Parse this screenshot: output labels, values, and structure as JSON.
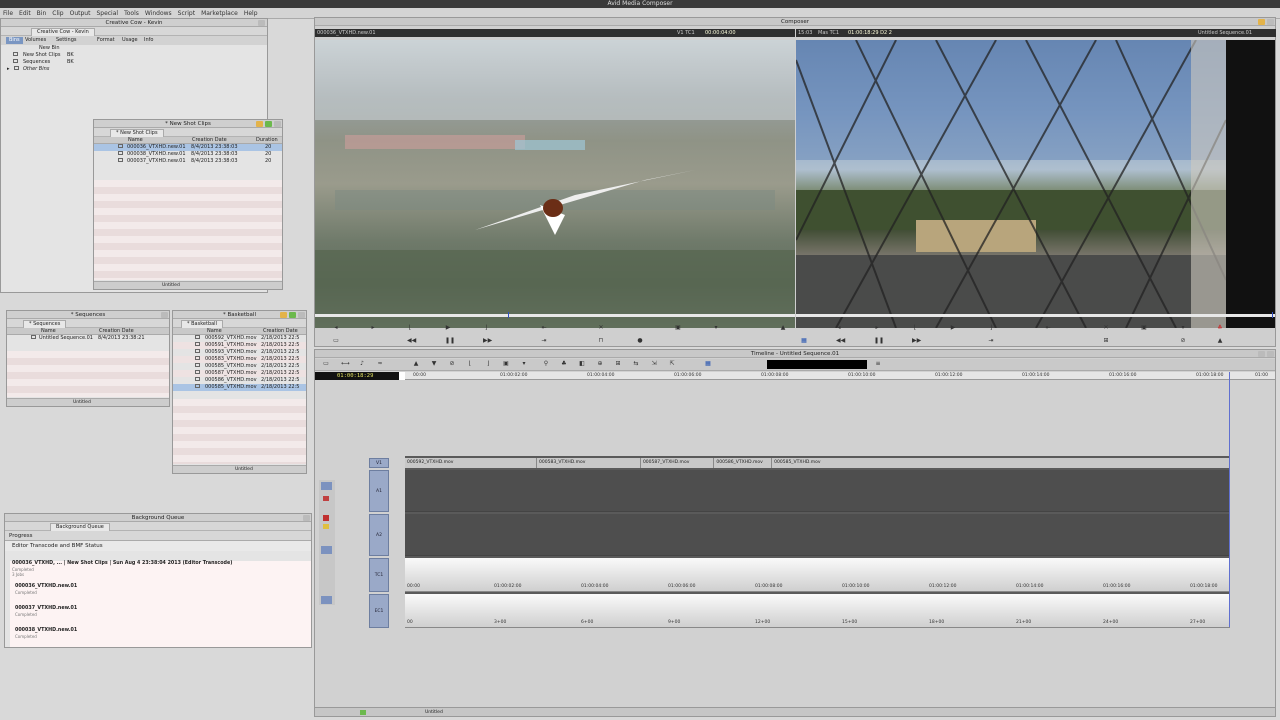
{
  "app": {
    "title": "Avid Media Composer"
  },
  "menu": [
    "File",
    "Edit",
    "Bin",
    "Clip",
    "Output",
    "Special",
    "Tools",
    "Windows",
    "Script",
    "Marketplace",
    "Help"
  ],
  "project_window": {
    "title": "Creative Cow - Kevin",
    "tab": "Creative Cow - Kevin",
    "tabs": [
      "Bins",
      "Volumes",
      "Settings",
      "Format",
      "Usage",
      "Info"
    ],
    "new_bin_button": "New Bin",
    "bins": [
      {
        "name": "New Shot Clips",
        "tag": "BK"
      },
      {
        "name": "Sequences",
        "tag": "BK"
      },
      {
        "name": "Other Bins",
        "tag": ""
      }
    ]
  },
  "new_shot_bin": {
    "title": "* New Shot Clips",
    "tab": "* New Shot Clips",
    "columns": [
      "Name",
      "Creation Date",
      "Duration"
    ],
    "rows": [
      {
        "name": "000036_VTXHD.new.01",
        "date": "8/4/2013 23:38:03",
        "dur": "20"
      },
      {
        "name": "000038_VTXHD.new.01",
        "date": "8/4/2013 23:38:03",
        "dur": "20"
      },
      {
        "name": "000037_VTXHD.new.01",
        "date": "8/4/2013 23:38:03",
        "dur": "20"
      }
    ],
    "footer_label": "Untitled"
  },
  "sequences_bin": {
    "title": "* Sequences",
    "tab": "* Sequences",
    "columns": [
      "Name",
      "Creation Date"
    ],
    "rows": [
      {
        "name": "Untitled Sequence.01",
        "date": "8/4/2013 23:38:21"
      }
    ],
    "footer_label": "Untitled"
  },
  "basketball_bin": {
    "title": "* Basketball",
    "tab": "* Basketball",
    "columns": [
      "Name",
      "Creation Date"
    ],
    "rows": [
      {
        "name": "000592_VTXHD.mov",
        "date": "2/18/2013 22:5"
      },
      {
        "name": "000591_VTXHD.mov",
        "date": "2/18/2013 22:5"
      },
      {
        "name": "000593_VTXHD.mov",
        "date": "2/18/2013 22:5"
      },
      {
        "name": "000583_VTXHD.mov",
        "date": "2/18/2013 22:5"
      },
      {
        "name": "000585_VTXHD.mov",
        "date": "2/18/2013 22:5"
      },
      {
        "name": "000587_VTXHD.mov",
        "date": "2/18/2013 22:5"
      },
      {
        "name": "000586_VTXHD.mov",
        "date": "2/18/2013 22:5"
      },
      {
        "name": "000585_VTXHD.mov",
        "date": "2/18/2013 22:5"
      }
    ],
    "footer_label": "Untitled"
  },
  "background_queue": {
    "title": "Background Queue",
    "tab": "Background Queue",
    "progress_label": "Progress",
    "section_title": "Editor Transcode and BMF Status",
    "job_title": "000036_VTXHD, ... | New Shot Clips | Sun Aug 4 23:38:04 2013 (Editor Transcode)",
    "job_status": "Completed",
    "jobs_count": "3 Jobs",
    "items": [
      {
        "name": "000036_VTXHD.new.01",
        "status": "Completed"
      },
      {
        "name": "000037_VTXHD.new.01",
        "status": "Completed"
      },
      {
        "name": "000038_VTXHD.new.01",
        "status": "Completed"
      }
    ]
  },
  "composer": {
    "title": "Composer",
    "source_clip": "000036_VTXHD.new.01",
    "track_label_1": "V1 TC1",
    "source_tc": "00:00:04:00",
    "rec_dur": "15:03",
    "mas_label": "Mas TC1",
    "master_tc": "01:00:18:29 D2 2",
    "record_seq": "Untitled Sequence.01"
  },
  "timeline": {
    "title": "Timeline - Untitled Sequence.01",
    "timecode": "01:00:18:29",
    "ruler": [
      "00:00",
      "01:00:02:00",
      "01:00:04:00",
      "01:00:06:00",
      "01:00:08:00",
      "01:00:10:00",
      "01:00:12:00",
      "01:00:14:00",
      "01:00:16:00",
      "01:00:18:00",
      "01:00"
    ],
    "tracks": [
      "V1",
      "A1",
      "A2",
      "TC1",
      "EC1"
    ],
    "clips": [
      {
        "name": "000592_VTXHD.mov",
        "start": 0,
        "end": 0.16
      },
      {
        "name": "000583_VTXHD.mov",
        "start": 0.16,
        "end": 0.286
      },
      {
        "name": "000587_VTXHD.mov",
        "start": 0.286,
        "end": 0.375
      },
      {
        "name": "000586_VTXHD.mov",
        "start": 0.375,
        "end": 0.445
      },
      {
        "name": "000585_VTXHD.mov",
        "start": 0.445,
        "end": 1.0
      }
    ],
    "tc1_labels": [
      "00:00",
      "01:00:02:00",
      "01:00:04:00",
      "01:00:06:00",
      "01:00:08:00",
      "01:00:10:00",
      "01:00:12:00",
      "01:00:14:00",
      "01:00:16:00",
      "01:00:18:00"
    ],
    "ec1_labels": [
      "00",
      "3+00",
      "6+00",
      "9+00",
      "12+00",
      "15+00",
      "18+00",
      "21+00",
      "24+00",
      "27+00"
    ],
    "footer_label": "Untitled"
  }
}
